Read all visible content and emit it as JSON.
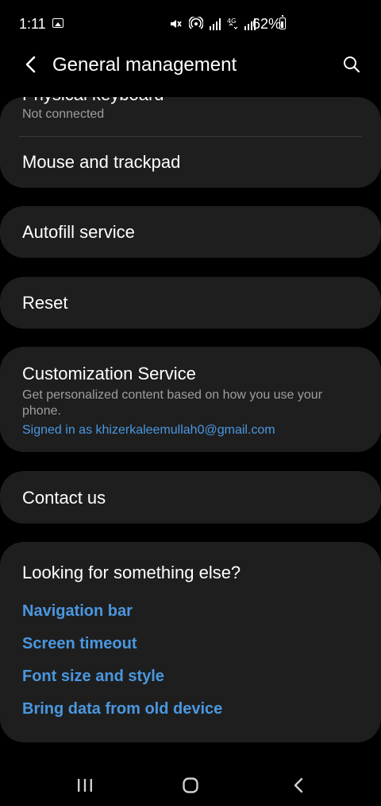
{
  "status_bar": {
    "time": "1:11",
    "battery": "62%",
    "icons": [
      "gallery-icon",
      "mute-icon",
      "hotspot-icon",
      "signal-icon",
      "4g-icon",
      "signal-icon",
      "battery-icon"
    ]
  },
  "header": {
    "title": "General management",
    "back_icon": "back-arrow-icon",
    "search_icon": "search-icon"
  },
  "items": {
    "physical_keyboard": {
      "title": "Physical keyboard",
      "subtitle": "Not connected"
    },
    "mouse_trackpad": {
      "title": "Mouse and trackpad"
    },
    "autofill": {
      "title": "Autofill service"
    },
    "reset": {
      "title": "Reset"
    },
    "customization": {
      "title": "Customization Service",
      "description": "Get personalized content based on how you use your phone.",
      "account": "Signed in as khizerkaleemullah0@gmail.com"
    },
    "contact_us": {
      "title": "Contact us"
    }
  },
  "suggestions": {
    "title": "Looking for something else?",
    "links": [
      "Navigation bar",
      "Screen timeout",
      "Font size and style",
      "Bring data from old device"
    ]
  },
  "nav_bar": {
    "icons": [
      "recent-apps-icon",
      "home-icon",
      "back-icon"
    ]
  },
  "colors": {
    "background": "#000000",
    "card": "#1e1e1e",
    "link": "#4a97e0",
    "subtext": "#9e9e9e"
  }
}
